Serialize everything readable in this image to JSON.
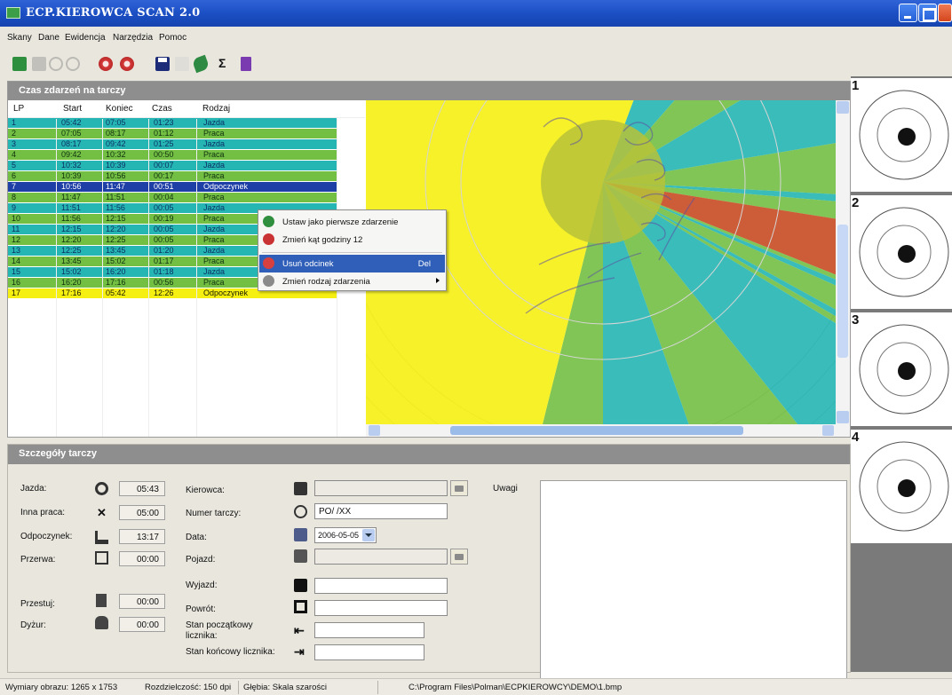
{
  "app": {
    "title": "ECP.KIEROWCA SCAN 2.0"
  },
  "menu": [
    "Skany",
    "Dane",
    "Ewidencja",
    "Narzędzia",
    "Pomoc"
  ],
  "toolbar_icons": [
    "open-icon",
    "copy-icon",
    "rotate-left-icon",
    "rotate-right-icon",
    "zoom-in-icon",
    "zoom-out-icon",
    "save-icon",
    "print-icon",
    "leaf-icon",
    "sigma-icon",
    "exit-icon"
  ],
  "events_panel": {
    "title": "Czas zdarzeń na tarczy",
    "columns": [
      "LP",
      "Start",
      "Koniec",
      "Czas",
      "Rodzaj"
    ],
    "rows": [
      {
        "lp": "1",
        "start": "05:42",
        "end": "07:05",
        "dur": "01:23",
        "type": "Jazda"
      },
      {
        "lp": "2",
        "start": "07:05",
        "end": "08:17",
        "dur": "01:12",
        "type": "Praca"
      },
      {
        "lp": "3",
        "start": "08:17",
        "end": "09:42",
        "dur": "01:25",
        "type": "Jazda"
      },
      {
        "lp": "4",
        "start": "09:42",
        "end": "10:32",
        "dur": "00:50",
        "type": "Praca"
      },
      {
        "lp": "5",
        "start": "10:32",
        "end": "10:39",
        "dur": "00:07",
        "type": "Jazda"
      },
      {
        "lp": "6",
        "start": "10:39",
        "end": "10:56",
        "dur": "00:17",
        "type": "Praca"
      },
      {
        "lp": "7",
        "start": "10:56",
        "end": "11:47",
        "dur": "00:51",
        "type": "Odpoczynek"
      },
      {
        "lp": "8",
        "start": "11:47",
        "end": "11:51",
        "dur": "00:04",
        "type": "Praca"
      },
      {
        "lp": "9",
        "start": "11:51",
        "end": "11:56",
        "dur": "00:05",
        "type": "Jazda"
      },
      {
        "lp": "10",
        "start": "11:56",
        "end": "12:15",
        "dur": "00:19",
        "type": "Praca"
      },
      {
        "lp": "11",
        "start": "12:15",
        "end": "12:20",
        "dur": "00:05",
        "type": "Jazda"
      },
      {
        "lp": "12",
        "start": "12:20",
        "end": "12:25",
        "dur": "00:05",
        "type": "Praca"
      },
      {
        "lp": "13",
        "start": "12:25",
        "end": "13:45",
        "dur": "01:20",
        "type": "Jazda"
      },
      {
        "lp": "14",
        "start": "13:45",
        "end": "15:02",
        "dur": "01:17",
        "type": "Praca"
      },
      {
        "lp": "15",
        "start": "15:02",
        "end": "16:20",
        "dur": "01:18",
        "type": "Jazda"
      },
      {
        "lp": "16",
        "start": "16:20",
        "end": "17:16",
        "dur": "00:56",
        "type": "Praca"
      },
      {
        "lp": "17",
        "start": "17:16",
        "end": "05:42",
        "dur": "12:26",
        "type": "Odpoczynek"
      }
    ],
    "selected_lp": "7"
  },
  "context_menu": {
    "items": [
      {
        "label": "Ustaw jako pierwsze zdarzenie",
        "icon": "set-first-icon"
      },
      {
        "label": "Zmień kąt godziny 12",
        "icon": "rotate-12-icon"
      },
      {
        "label": "Usuń odcinek",
        "icon": "delete-icon",
        "shortcut": "Del",
        "active": true
      },
      {
        "label": "Zmień rodzaj zdarzenia",
        "icon": "change-type-icon",
        "submenu": true
      }
    ]
  },
  "details_panel": {
    "title": "Szczegóły tarczy",
    "totals": [
      {
        "label": "Jazda:",
        "value": "05:43",
        "icon": "steering-wheel-icon"
      },
      {
        "label": "Inna praca:",
        "value": "05:00",
        "icon": "hammers-icon"
      },
      {
        "label": "Odpoczynek:",
        "value": "13:17",
        "icon": "bed-icon"
      },
      {
        "label": "Przerwa:",
        "value": "00:00",
        "icon": "break-icon"
      },
      {
        "label": "Przestuj:",
        "value": "00:00",
        "icon": "building-icon"
      },
      {
        "label": "Dyżur:",
        "value": "00:00",
        "icon": "phone-icon"
      }
    ],
    "fields": {
      "kierowca_label": "Kierowca:",
      "kierowca_value": "",
      "numer_label": "Numer tarczy:",
      "numer_value": "PO/ /XX",
      "data_label": "Data:",
      "data_value": "2006-05-05",
      "pojazd_label": "Pojazd:",
      "pojazd_value": "",
      "wyjazd_label": "Wyjazd:",
      "wyjazd_value": "",
      "powrot_label": "Powrót:",
      "powrot_value": "",
      "stan_pocz_label_1": "Stan początkowy",
      "stan_pocz_label_2": "licznika:",
      "stan_pocz_value": "",
      "stan_konc_label": "Stan końcowy licznika:",
      "stan_konc_value": "",
      "uwagi_label": "Uwagi"
    }
  },
  "thumbnails": [
    "1",
    "2",
    "3",
    "4"
  ],
  "statusbar": {
    "dims": "Wymiary obrazu: 1265 x 1753",
    "resolution": "Rozdzielczość: 150 dpi",
    "depth": "Głębia: Skala szarości",
    "path": "C:\\Program Files\\Polman\\ECPKIEROWCY\\DEMO\\1.bmp"
  },
  "colors": {
    "jazda": "#25b6b3",
    "praca": "#72bf43",
    "odpoczynek": "#f6ef12",
    "selected": "#1d3fa6",
    "delete_segment": "#c84b22"
  }
}
